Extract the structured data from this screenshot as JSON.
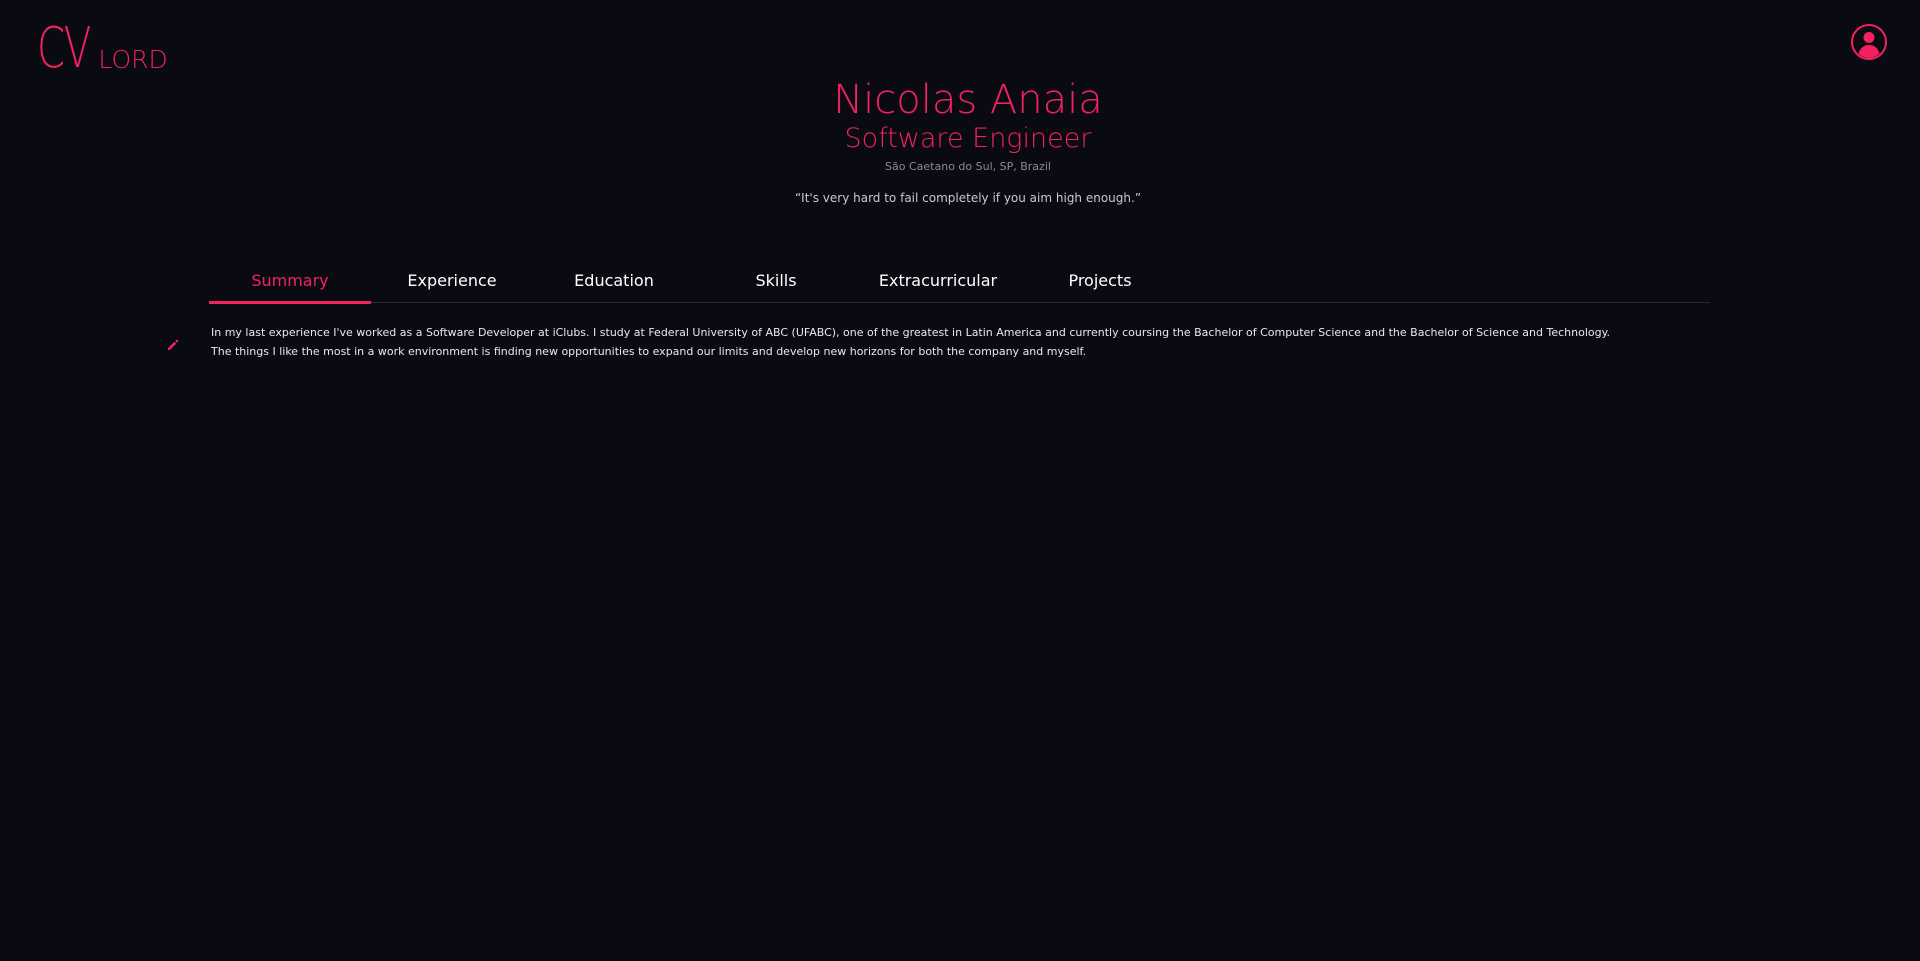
{
  "logo": {
    "primary": "CV",
    "secondary": "LORD"
  },
  "header": {
    "name": "Nicolas Anaia",
    "title": "Software Engineer",
    "location": "São Caetano do Sul, SP, Brazil",
    "quote": "“It's very hard to fail completely if you aim high enough.”"
  },
  "tabs": [
    {
      "label": "Summary",
      "active": true
    },
    {
      "label": "Experience",
      "active": false
    },
    {
      "label": "Education",
      "active": false
    },
    {
      "label": "Skills",
      "active": false
    },
    {
      "label": "Extracurricular",
      "active": false
    },
    {
      "label": "Projects",
      "active": false
    }
  ],
  "summary": {
    "line1": "In my last experience I've worked as a Software Developer at iClubs. I study at Federal University of ABC (UFABC), one of the greatest in Latin America and currently coursing the Bachelor of Computer Science and the Bachelor of Science and Technology.",
    "line2": "The things I like the most in a work environment is finding new opportunities to expand our limits and develop new horizons for both the company and myself."
  },
  "icons": {
    "profile": "user-circle-icon",
    "edit": "pencil-icon"
  },
  "colors": {
    "accent": "#f2215f",
    "background": "#0a0a13",
    "text": "#ffffff",
    "muted": "#8a8a99",
    "divider": "#2a2a36"
  }
}
